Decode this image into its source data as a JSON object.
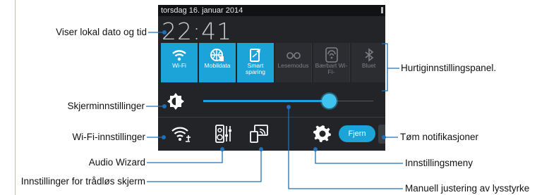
{
  "status_bar": {
    "date": "torsdag 16. januar 2014"
  },
  "clock": {
    "time": "22:41"
  },
  "quick_settings": [
    {
      "label": "Wi-Fi",
      "icon": "wifi-icon",
      "state": "on"
    },
    {
      "label": "Mobildata",
      "icon": "mobile-data-icon",
      "state": "on"
    },
    {
      "label": "Smart sparing",
      "icon": "smart-saving-icon",
      "state": "on"
    },
    {
      "label": "Lesemodus",
      "icon": "reading-mode-icon",
      "state": "off"
    },
    {
      "label": "Bærbart Wi-Fi-",
      "icon": "hotspot-icon",
      "state": "off"
    },
    {
      "label": "Bluet",
      "icon": "bluetooth-icon",
      "state": "off"
    }
  ],
  "brightness": {
    "level": 0.74
  },
  "bottom_bar": {
    "clear_button": "Fjern"
  },
  "callouts": {
    "date_time": "Viser lokal dato og tid",
    "quick_panel": "Hurtiginnstillingspanel.",
    "display_settings": "Skjerminnstillinger",
    "wifi_settings": "Wi-Fi-innstillinger",
    "clear_notifications": "Tøm notifikasjoner",
    "audio_wizard": "Audio Wizard",
    "settings_menu": "Innstillingsmeny",
    "wireless_display": "Innstillinger for trådløs skjerm",
    "manual_brightness": "Manuell justering av lysstyrke"
  },
  "colors": {
    "accent": "#1ca3d8",
    "callout_line": "#1e6fb8",
    "panel_bg": "#222428"
  }
}
